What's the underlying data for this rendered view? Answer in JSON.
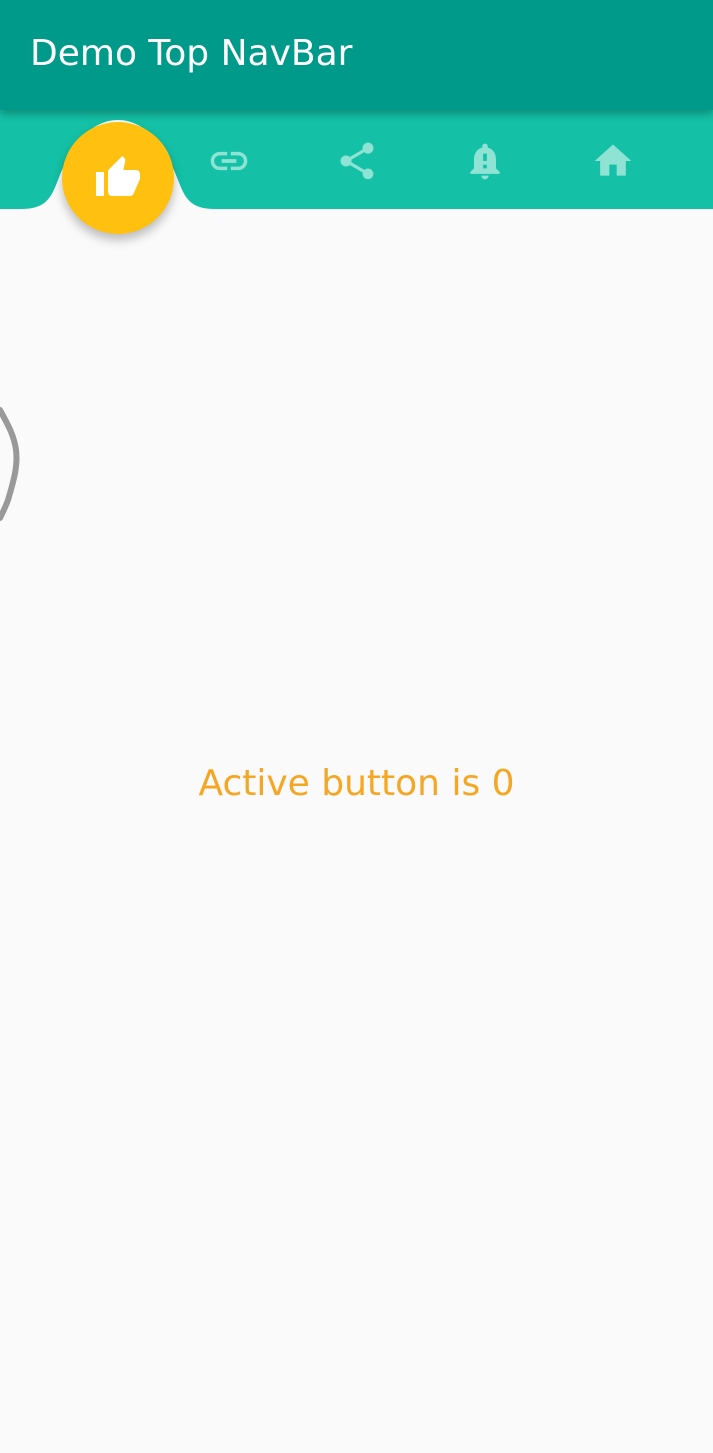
{
  "app_bar": {
    "title": "Demo Top NavBar",
    "color": "#009a8b"
  },
  "nav_bar": {
    "color": "#14c1a6",
    "active_index": 0,
    "active_color": "#ffc010",
    "inactive_icon_color": "#8fe3d4",
    "items": [
      {
        "icon": "thumb-up-icon",
        "active": true
      },
      {
        "icon": "link-icon",
        "active": false
      },
      {
        "icon": "share-icon",
        "active": false
      },
      {
        "icon": "notification-alert-icon",
        "active": false
      },
      {
        "icon": "home-icon",
        "active": false
      }
    ]
  },
  "body": {
    "message": "Active button is 0",
    "message_color": "#f5a623"
  }
}
